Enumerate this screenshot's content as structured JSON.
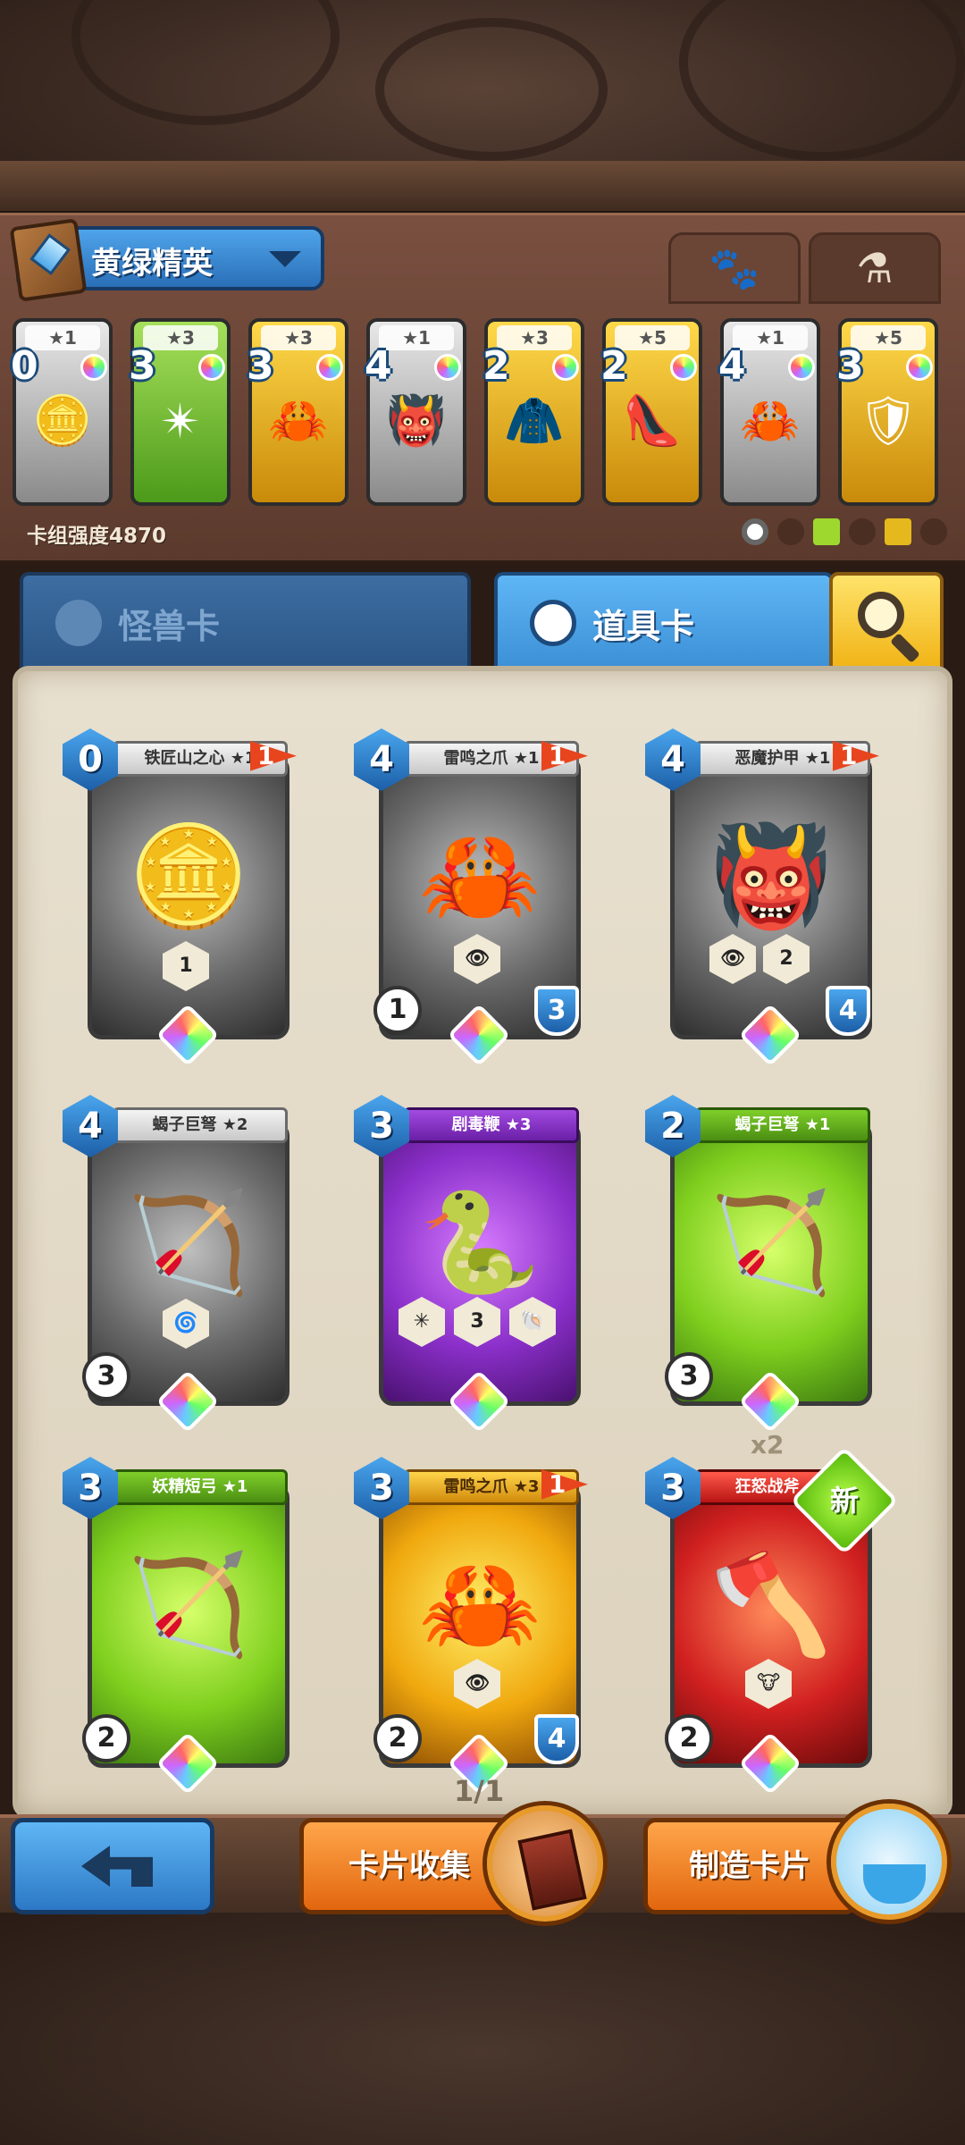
{
  "header": {
    "deck_name": "黄绿精英",
    "tabs": [
      {
        "icon": "paw-icon",
        "active": false
      },
      {
        "icon": "potion-icon",
        "active": true
      }
    ]
  },
  "deck": {
    "cards": [
      {
        "cost": "0",
        "stars": "★1",
        "frame": "gray",
        "icon": "coin-medal-icon",
        "art": "🪙"
      },
      {
        "cost": "3",
        "stars": "★3",
        "frame": "green",
        "icon": "shuriken-icon",
        "art": "✴"
      },
      {
        "cost": "3",
        "stars": "★3",
        "frame": "yellow",
        "icon": "claw-icon",
        "art": "🦀"
      },
      {
        "cost": "4",
        "stars": "★1",
        "frame": "gray",
        "icon": "demon-armor-icon",
        "art": "👹"
      },
      {
        "cost": "2",
        "stars": "★3",
        "frame": "yellow",
        "icon": "cape-icon",
        "art": "🧥"
      },
      {
        "cost": "2",
        "stars": "★5",
        "frame": "yellow",
        "icon": "glass-slipper-icon",
        "art": "👠"
      },
      {
        "cost": "4",
        "stars": "★1",
        "frame": "gray",
        "icon": "claw-icon",
        "art": "🦀"
      },
      {
        "cost": "3",
        "stars": "★5",
        "frame": "yellow",
        "icon": "chest-armor-icon",
        "art": "🛡"
      }
    ],
    "strength": "卡组强度4870"
  },
  "categories": {
    "monster_label": "怪兽卡",
    "item_label": "道具卡"
  },
  "collection": {
    "cards": [
      {
        "name": "铁匠山之心 ★1",
        "cost": "0",
        "level": "1",
        "frame": "gray",
        "banner": "",
        "icon": "coin-medal-icon",
        "art": "🪙",
        "left_stat": "",
        "right_stat": "",
        "hex1": "1"
      },
      {
        "name": "雷鸣之爪 ★1",
        "cost": "4",
        "level": "1",
        "frame": "gray",
        "banner": "",
        "icon": "claw-icon",
        "art": "🦀",
        "left_stat": "1",
        "right_stat": "3",
        "hex1": ""
      },
      {
        "name": "恶魔护甲 ★1",
        "cost": "4",
        "level": "1",
        "frame": "gray",
        "banner": "",
        "icon": "demon-armor-icon",
        "art": "👹",
        "left_stat": "",
        "right_stat": "4",
        "hex1": "2"
      },
      {
        "name": "蝎子巨弩 ★2",
        "cost": "4",
        "level": "",
        "frame": "gray",
        "banner": "",
        "icon": "crossbow-icon",
        "art": "🏹",
        "left_stat": "3",
        "right_stat": "",
        "hex1": ""
      },
      {
        "name": "剧毒鞭 ★3",
        "cost": "3",
        "level": "",
        "frame": "purple",
        "banner": "purple",
        "icon": "whip-icon",
        "art": "🐍",
        "left_stat": "",
        "right_stat": "",
        "hex1": "3"
      },
      {
        "name": "蝎子巨弩 ★1",
        "cost": "2",
        "level": "",
        "frame": "green",
        "banner": "green",
        "icon": "crossbow-icon",
        "art": "🏹",
        "left_stat": "3",
        "right_stat": "",
        "hex1": ""
      },
      {
        "name": "妖精短弓 ★1",
        "cost": "3",
        "level": "",
        "frame": "green",
        "banner": "green",
        "icon": "bow-icon",
        "art": "🏹",
        "left_stat": "2",
        "right_stat": "",
        "hex1": ""
      },
      {
        "name": "雷鸣之爪 ★3",
        "cost": "3",
        "level": "1",
        "frame": "gold",
        "banner": "gold",
        "icon": "claw-icon",
        "art": "🦀",
        "left_stat": "2",
        "right_stat": "4",
        "hex1": ""
      },
      {
        "name": "狂怒战斧 ★1",
        "cost": "3",
        "level": "",
        "frame": "red",
        "banner": "red",
        "icon": "battle-axe-icon",
        "art": "🪓",
        "left_stat": "2",
        "right_stat": "",
        "hex1": ""
      }
    ],
    "duplicate_badge": "x2",
    "new_badge": "新",
    "pager": "1/1"
  },
  "bottom": {
    "collect_label": "卡片收集",
    "craft_label": "制造卡片"
  }
}
